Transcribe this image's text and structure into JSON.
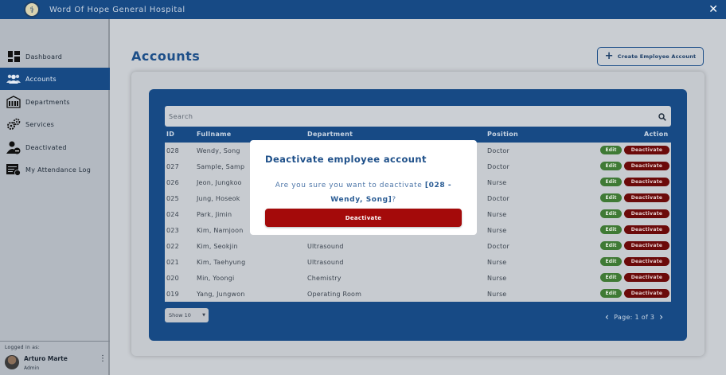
{
  "app": {
    "title": "Word Of Hope General Hospital",
    "logo_glyph": "⚕"
  },
  "sidebar": {
    "items": [
      {
        "label": "Dashboard",
        "icon": "dashboard-icon"
      },
      {
        "label": "Accounts",
        "icon": "users-icon",
        "active": true
      },
      {
        "label": "Departments",
        "icon": "building-icon"
      },
      {
        "label": "Services",
        "icon": "gears-icon"
      },
      {
        "label": "Deactivated",
        "icon": "user-deactivated-icon"
      },
      {
        "label": "My Attendance Log",
        "icon": "attendance-log-icon"
      }
    ],
    "logged_in_label": "Logged in as:",
    "user_name": "Arturo Marte",
    "user_role": "Admin"
  },
  "main": {
    "title": "Accounts",
    "create_button": "Create Employee Account",
    "search_placeholder": "Search",
    "columns": {
      "id": "ID",
      "fullname": "Fullname",
      "department": "Department",
      "position": "Position",
      "action": "Action"
    },
    "rows": [
      {
        "id": "028",
        "name": "Wendy, Song",
        "department": "",
        "position": "Doctor"
      },
      {
        "id": "027",
        "name": "Sample, Samp",
        "department": "",
        "position": "Doctor"
      },
      {
        "id": "026",
        "name": "Jeon, Jungkoo",
        "department": "",
        "position": "Nurse"
      },
      {
        "id": "025",
        "name": "Jung, Hoseok",
        "department": "",
        "position": "Doctor"
      },
      {
        "id": "024",
        "name": "Park, Jimin",
        "department": "",
        "position": "Nurse"
      },
      {
        "id": "023",
        "name": "Kim, Namjoon",
        "department": "",
        "position": "Nurse"
      },
      {
        "id": "022",
        "name": "Kim, Seokjin",
        "department": "Ultrasound",
        "position": "Doctor"
      },
      {
        "id": "021",
        "name": "Kim, Taehyung",
        "department": "Ultrasound",
        "position": "Nurse"
      },
      {
        "id": "020",
        "name": "Min, Yoongi",
        "department": "Chemistry",
        "position": "Nurse"
      },
      {
        "id": "019",
        "name": "Yang, Jungwon",
        "department": "Operating Room",
        "position": "Nurse"
      }
    ],
    "edit_label": "Edit",
    "deactivate_label": "Deactivate",
    "show_select": "Show 10",
    "pagination": "Page: 1 of 3"
  },
  "modal": {
    "title": "Deactivate employee account",
    "message_prefix": "Are you sure you want to deactivate ",
    "message_target": "[028 - Wendy, Song]",
    "message_suffix": "?",
    "button": "Deactivate"
  },
  "colors": {
    "primary": "#174a85",
    "danger": "#a40a0a",
    "edit": "#3f7a35"
  }
}
